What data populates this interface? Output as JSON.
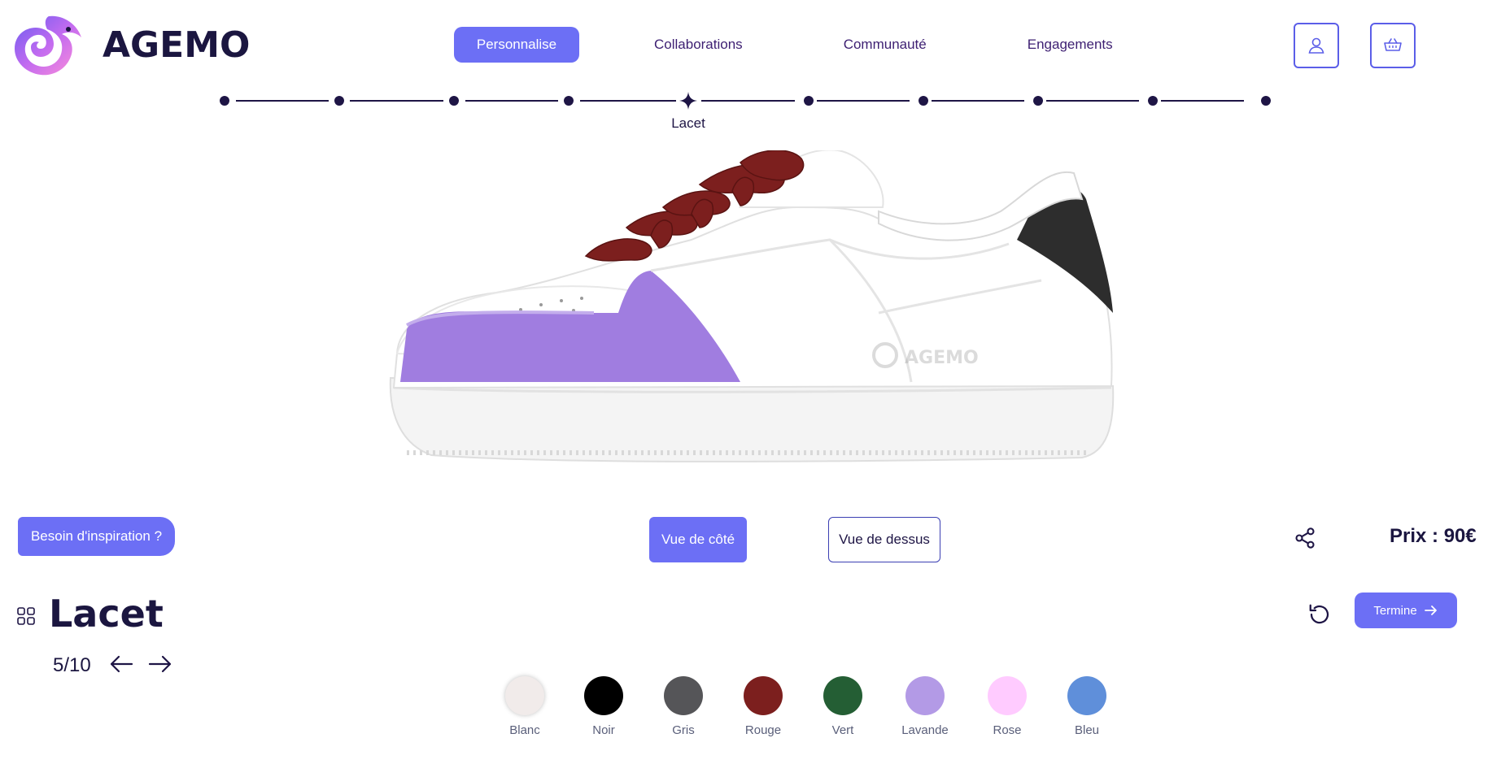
{
  "brand": {
    "name": "AGEMO"
  },
  "nav": {
    "items": [
      {
        "label": "Personnalise",
        "active": true
      },
      {
        "label": "Collaborations",
        "active": false
      },
      {
        "label": "Communauté",
        "active": false
      },
      {
        "label": "Engagements",
        "active": false
      }
    ],
    "user_icon": "user-icon",
    "cart_icon": "basket-icon"
  },
  "stepper": {
    "total": 10,
    "current": 5,
    "current_label": "Lacet"
  },
  "shoe": {
    "brand_mark": "AGEMO",
    "lace_color": "#7c1f1e",
    "accent_color": "#a07de0",
    "heel_color": "#2d2d2d"
  },
  "controls": {
    "inspiration_label": "Besoin d'inspiration ?",
    "view_side_label": "Vue de côté",
    "view_top_label": "Vue de dessus",
    "price_label": "Prix : 90€",
    "share_icon": "share-icon"
  },
  "section": {
    "title": "Lacet",
    "step_counter": "5/10",
    "done_label": "Termine",
    "reset_icon": "reset-icon"
  },
  "colors": [
    {
      "name": "Blanc",
      "hex": "#f1ebea",
      "selected": false
    },
    {
      "name": "Noir",
      "hex": "#000000",
      "selected": false
    },
    {
      "name": "Gris",
      "hex": "#555558",
      "selected": false
    },
    {
      "name": "Rouge",
      "hex": "#7c1f1e",
      "selected": true
    },
    {
      "name": "Vert",
      "hex": "#245e34",
      "selected": false
    },
    {
      "name": "Lavande",
      "hex": "#b39ae6",
      "selected": false
    },
    {
      "name": "Rose",
      "hex": "#ffcbff",
      "selected": false
    },
    {
      "name": "Bleu",
      "hex": "#5f8fda",
      "selected": false
    }
  ]
}
